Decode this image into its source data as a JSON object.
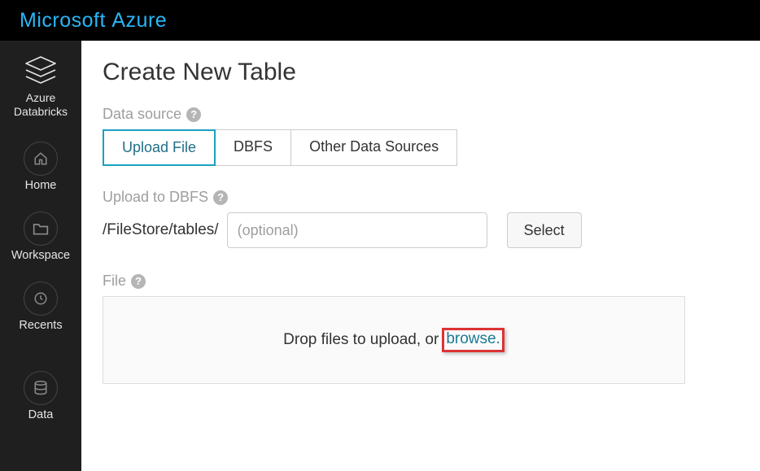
{
  "brand": {
    "part1": "Microsoft ",
    "part2": "Azure"
  },
  "sidebar": {
    "product": "Azure\nDatabricks",
    "items": [
      {
        "label": "Home"
      },
      {
        "label": "Workspace"
      },
      {
        "label": "Recents"
      },
      {
        "label": "Data"
      }
    ]
  },
  "page": {
    "title": "Create New Table",
    "dataSourceLabel": "Data source",
    "tabs": [
      {
        "label": "Upload File",
        "active": true
      },
      {
        "label": "DBFS",
        "active": false
      },
      {
        "label": "Other Data Sources",
        "active": false
      }
    ],
    "uploadLabel": "Upload to DBFS",
    "pathPrefix": "/FileStore/tables/",
    "pathPlaceholder": "(optional)",
    "pathValue": "",
    "selectLabel": "Select",
    "fileLabel": "File",
    "dropText": "Drop files to upload, or ",
    "browseText": "browse."
  }
}
